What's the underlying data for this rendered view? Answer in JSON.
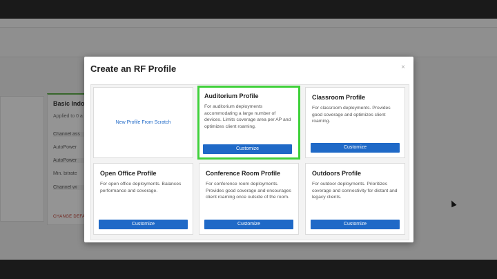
{
  "background": {
    "card_title": "Basic Indo",
    "card_subtitle": "Applied to 0 a",
    "rows": [
      "Channel ass",
      "AutoPower",
      "AutoPower",
      "Min. bitrate",
      "Channel wi"
    ],
    "link": "CHANGE DEFA"
  },
  "modal": {
    "title": "Create an RF Profile",
    "close_label": "×",
    "scratch_label": "New Profile From Scratch",
    "customize_label": "Customize",
    "tiles": [
      {
        "title": "Auditorium Profile",
        "description": "For auditorium deployments accommodating a large number of devices. Limits coverage area per AP and optimizes client roaming."
      },
      {
        "title": "Classroom Profile",
        "description": "For classroom deployments. Provides good coverage and optimizes client roaming."
      },
      {
        "title": "Open Office Profile",
        "description": "For open office deployments. Balances performance and coverage."
      },
      {
        "title": "Conference Room Profile",
        "description": "For conference room deployments. Provides good coverage and encourages client roaming once outside of the room."
      },
      {
        "title": "Outdoors Profile",
        "description": "For outdoor deployments. Prioritizes coverage and connectivity for distant and legacy clients."
      }
    ]
  },
  "colors": {
    "accent": "#1f69c7",
    "selected_border": "#3fd13a"
  }
}
